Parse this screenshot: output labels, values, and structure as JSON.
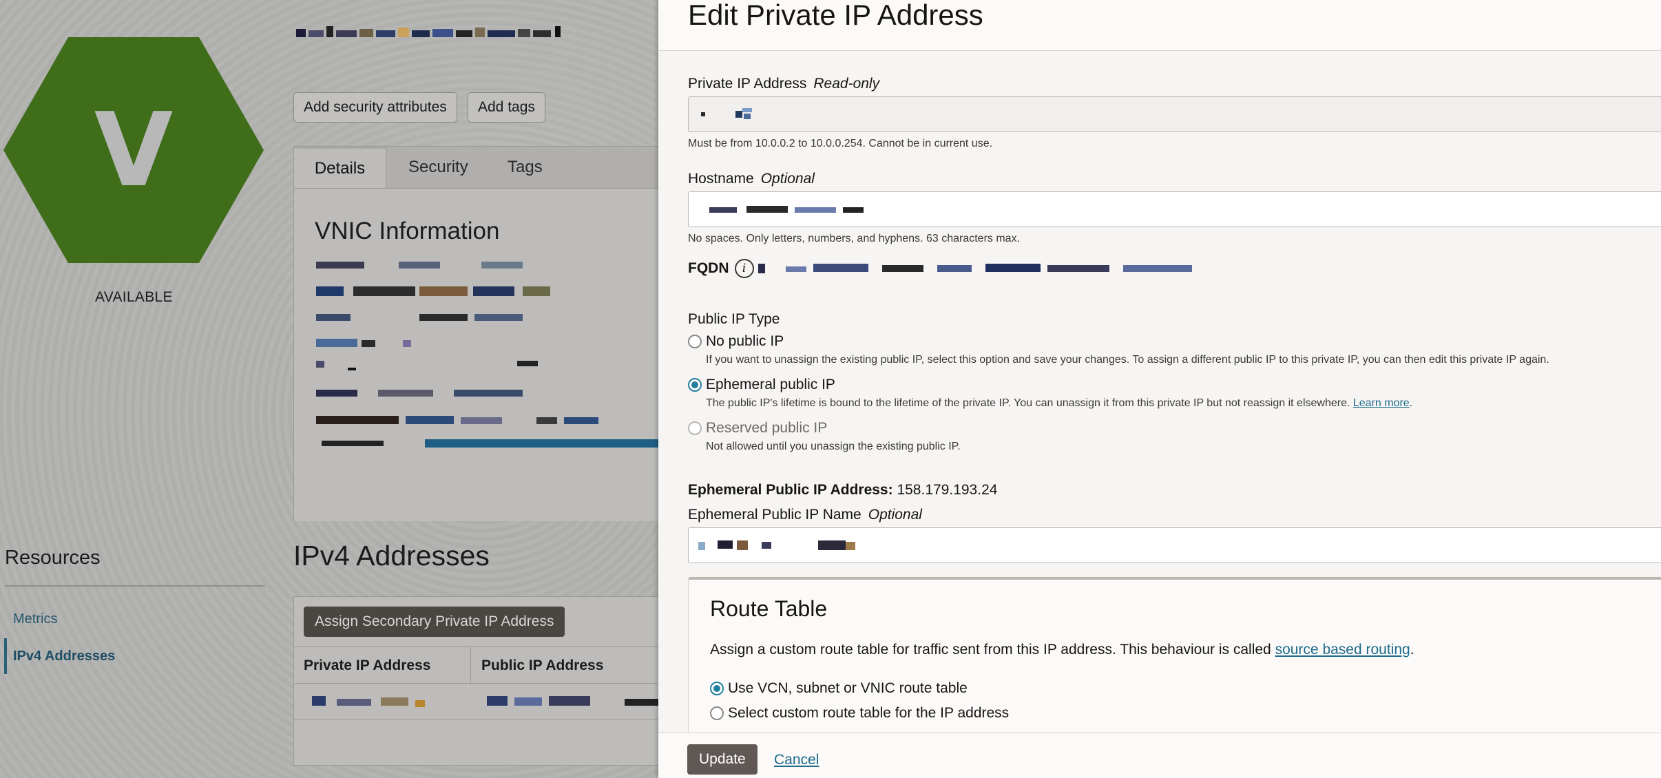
{
  "background": {
    "status": "AVAILABLE",
    "hex_letter": "V",
    "buttons": {
      "add_security": "Add security attributes",
      "add_tags": "Add tags"
    },
    "tabs": [
      {
        "label": "Details"
      },
      {
        "label": "Security"
      },
      {
        "label": "Tags"
      }
    ],
    "vnic_title": "VNIC Information",
    "resources": {
      "title": "Resources",
      "items": [
        {
          "label": "Metrics"
        },
        {
          "label": "IPv4 Addresses"
        }
      ]
    },
    "ipv4": {
      "title": "IPv4 Addresses",
      "assign_button": "Assign Secondary Private IP Address",
      "columns": [
        "Private IP Address",
        "Public IP Address"
      ]
    },
    "colors": {
      "hex_fill": "#3f6d1a",
      "overlay_bg": "#b2b2b0"
    }
  },
  "panel": {
    "title": "Edit Private IP Address",
    "private_ip": {
      "label": "Private IP Address",
      "hint": "Read-only",
      "helper": "Must be from 10.0.0.2 to 10.0.0.254. Cannot be in current use."
    },
    "hostname": {
      "label": "Hostname",
      "hint": "Optional",
      "helper": "No spaces. Only letters, numbers, and hyphens. 63 characters max."
    },
    "fqdn_label": "FQDN",
    "public_ip_type": {
      "label": "Public IP Type",
      "options": [
        {
          "label": "No public IP",
          "desc": "If you want to unassign the existing public IP, select this option and save your changes. To assign a different public IP to this private IP, you can then edit this private IP again."
        },
        {
          "label": "Ephemeral public IP",
          "desc": "The public IP's lifetime is bound to the lifetime of the private IP. You can unassign it from this private IP but not reassign it elsewhere.",
          "link": "Learn more"
        },
        {
          "label": "Reserved public IP",
          "desc": "Not allowed until you unassign the existing public IP."
        }
      ]
    },
    "ephemeral": {
      "label": "Ephemeral Public IP Address:",
      "value": "158.179.193.24",
      "name_label": "Ephemeral Public IP Name",
      "name_hint": "Optional"
    },
    "route_table": {
      "title": "Route Table",
      "desc": "Assign a custom route table for traffic sent from this IP address. This behaviour is called",
      "desc_link": "source based routing",
      "options": [
        {
          "label": "Use VCN, subnet or VNIC route table"
        },
        {
          "label": "Select custom route table for the IP address"
        }
      ]
    },
    "footer": {
      "update": "Update",
      "cancel": "Cancel"
    },
    "colors": {
      "accent": "#227e9e",
      "link": "#1d6a8c",
      "update_btn": "#5f5854"
    }
  }
}
